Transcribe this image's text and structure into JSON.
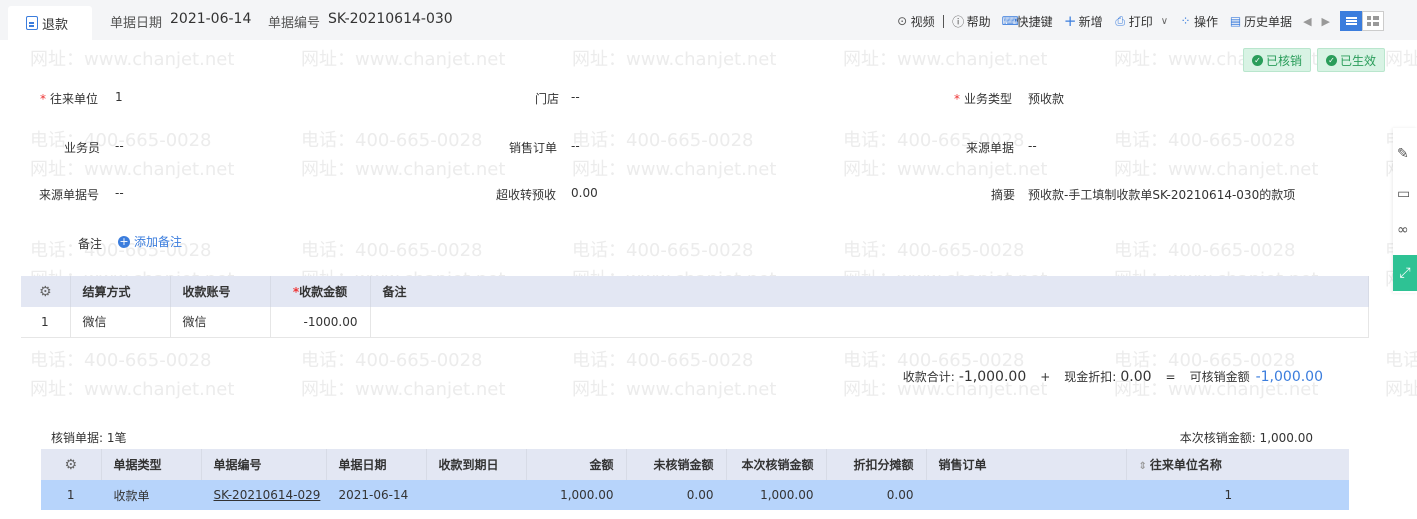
{
  "tab": {
    "label": "退款"
  },
  "header": {
    "date_label": "单据日期",
    "date_value": "2021-06-14",
    "number_label": "单据编号",
    "number_value": "SK-20210614-030"
  },
  "toolbar": {
    "video": "视频",
    "help": "帮助",
    "shortcut": "快捷键",
    "add": "新增",
    "print": "打印",
    "operate": "操作",
    "history": "历史单据"
  },
  "badges": {
    "verified": "已核销",
    "effective": "已生效"
  },
  "watermark": {
    "phone": "电话：400-665-0028",
    "site": "网址：www.chanjet.net"
  },
  "form": {
    "partner_label": "往来单位",
    "partner_value": "1",
    "store_label": "门店",
    "store_value": "--",
    "biz_type_label": "业务类型",
    "biz_type_value": "预收款",
    "salesman_label": "业务员",
    "salesman_value": "--",
    "sales_order_label": "销售订单",
    "sales_order_value": "--",
    "source_doc_label": "来源单据",
    "source_doc_value": "--",
    "source_no_label": "来源单据号",
    "source_no_value": "--",
    "over_label": "超收转预收",
    "over_value": "0.00",
    "summary_label": "摘要",
    "summary_value": "预收款-手工填制收款单SK-20210614-030的款项",
    "note_label": "备注",
    "add_note": "添加备注"
  },
  "payment_table": {
    "headers": [
      "结算方式",
      "收款账号",
      "收款金额",
      "备注"
    ],
    "rows": [
      {
        "index": "1",
        "method": "微信",
        "account": "微信",
        "amount": "-1000.00",
        "note": ""
      }
    ]
  },
  "summary": {
    "total_label": "收款合计:",
    "total_value": "-1,000.00",
    "plus": "+",
    "discount_label": "现金折扣:",
    "discount_value": "0.00",
    "equals": "=",
    "writeoff_label": "可核销金额",
    "writeoff_value": "-1,000.00"
  },
  "writeoff": {
    "count_text": "核销单据: 1笔",
    "amount_text": "本次核销金额: 1,000.00",
    "headers": [
      "单据类型",
      "单据编号",
      "单据日期",
      "收款到期日",
      "金额",
      "未核销金额",
      "本次核销金额",
      "折扣分摊额",
      "销售订单",
      "往来单位名称"
    ],
    "rows": [
      {
        "index": "1",
        "type": "收款单",
        "number": "SK-20210614-029",
        "date": "2021-06-14",
        "due": "",
        "amount": "1,000.00",
        "unverified": "0.00",
        "this_time": "1,000.00",
        "discount": "0.00",
        "order": "",
        "partner": "1"
      }
    ]
  },
  "colors": {
    "accent": "#3b7ddd",
    "badge_green": "#2a9d5a",
    "header_row": "#e3e7f3",
    "selected_row": "#b7d4fb",
    "side_green": "#2ec294"
  }
}
